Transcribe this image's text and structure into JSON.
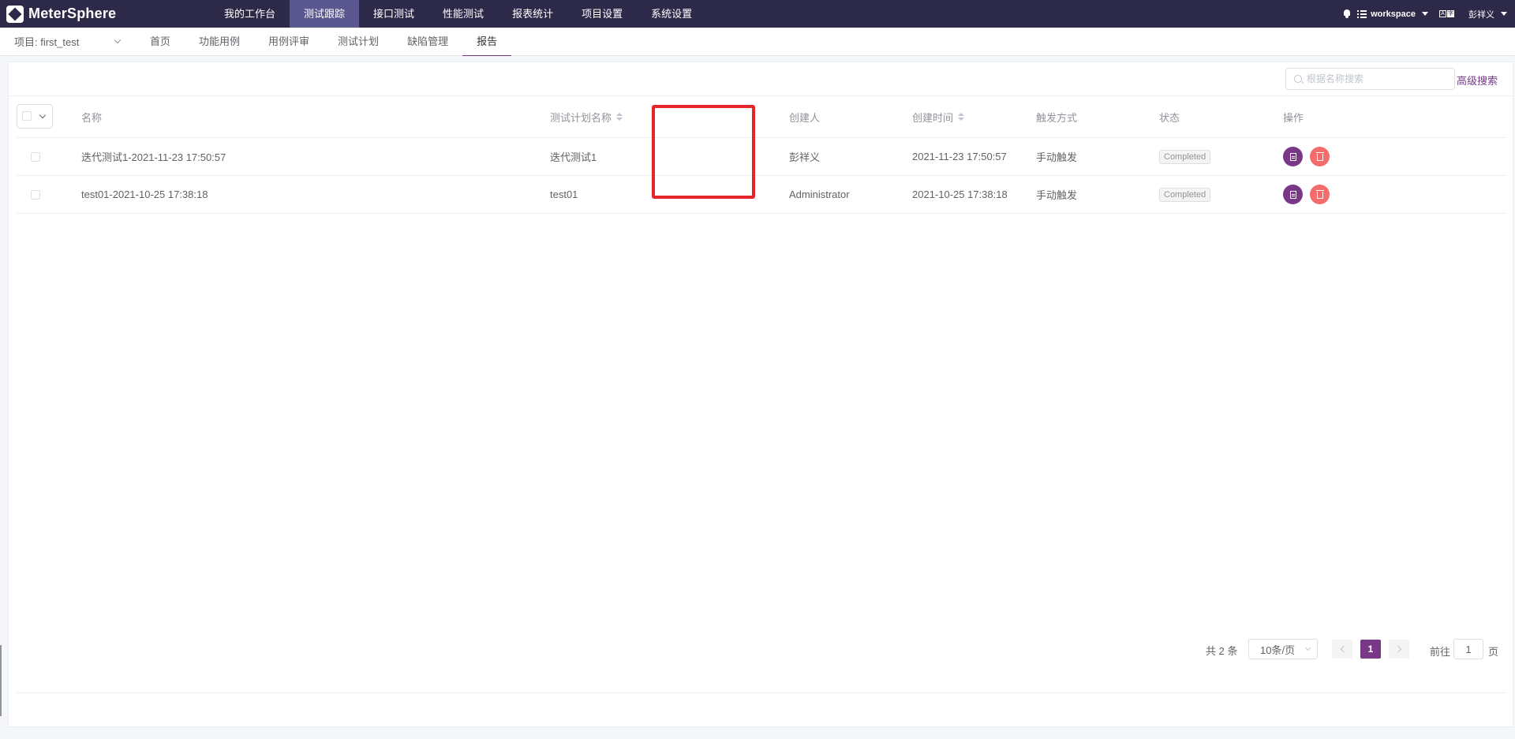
{
  "topbar": {
    "logo_text": "MeterSphere",
    "nav": [
      {
        "label": "我的工作台",
        "active": false
      },
      {
        "label": "测试跟踪",
        "active": true
      },
      {
        "label": "接口测试",
        "active": false
      },
      {
        "label": "性能测试",
        "active": false
      },
      {
        "label": "报表统计",
        "active": false
      },
      {
        "label": "项目设置",
        "active": false
      },
      {
        "label": "系统设置",
        "active": false
      }
    ],
    "workspace": "workspace",
    "user": "彭祥义",
    "lang_icon": [
      "A",
      "字"
    ]
  },
  "subbar": {
    "project": "项目: first_test",
    "nav": [
      {
        "label": "首页",
        "active": false
      },
      {
        "label": "功能用例",
        "active": false
      },
      {
        "label": "用例评审",
        "active": false
      },
      {
        "label": "测试计划",
        "active": false
      },
      {
        "label": "缺陷管理",
        "active": false
      },
      {
        "label": "报告",
        "active": true
      }
    ]
  },
  "toolbar": {
    "search_placeholder": "根据名称搜索",
    "advanced_search": "高级搜索"
  },
  "table": {
    "columns": [
      "名称",
      "测试计划名称",
      "创建人",
      "创建时间",
      "触发方式",
      "状态",
      "操作"
    ],
    "rows": [
      {
        "name": "迭代测试1-2021-11-23 17:50:57",
        "plan": "迭代测试1",
        "creator": "彭祥义",
        "created": "2021-11-23 17:50:57",
        "trigger": "手动触发",
        "status": "Completed"
      },
      {
        "name": "test01-2021-10-25 17:38:18",
        "plan": "test01",
        "creator": "Administrator",
        "created": "2021-10-25 17:38:18",
        "trigger": "手动触发",
        "status": "Completed"
      }
    ]
  },
  "pagination": {
    "total": "共 2 条",
    "page_size": "10条/页",
    "current_page": "1",
    "goto_label": "前往",
    "goto_value": "1",
    "goto_suffix": "页"
  },
  "colors": {
    "nav_bg": "#2c2a48",
    "nav_active": "#5b578f",
    "accent": "#783887",
    "danger": "#f56c6c",
    "highlight_box": "#e5252a"
  }
}
